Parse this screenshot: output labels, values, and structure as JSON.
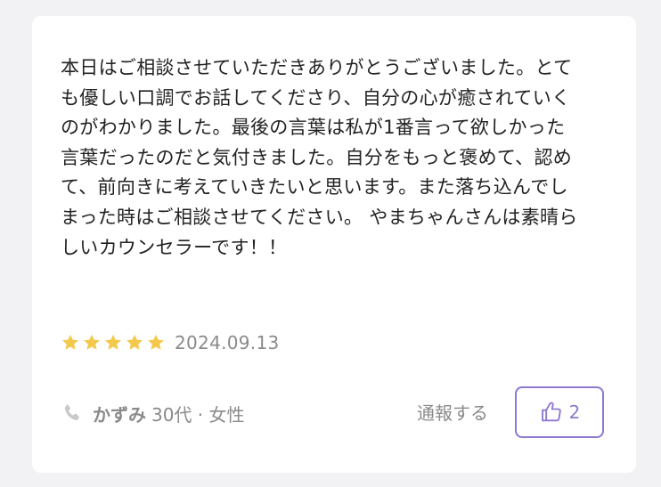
{
  "review": {
    "body_lines": [
      "本日はご相談させていただきありがとうございました。とて",
      "も優しい口調でお話してくださり、自分の心が癒されていく",
      "のがわかりました。最後の言葉は私が1番言って欲しかった",
      "言葉だったのだと気付きました。自分をもっと褒めて、認め",
      "て、前向きに考えていきたいと思います。また落ち込んでし",
      "まった時はご相談させてください。 やまちゃんさんは素晴ら",
      "しいカウンセラーです！！"
    ],
    "rating": 5,
    "rating_max": 5,
    "date": "2024.09.13",
    "author": {
      "name": "かずみ",
      "meta": "30代 · 女性",
      "icon": "phone-icon"
    },
    "report_label": "通報する",
    "like": {
      "icon": "thumbs-up-icon",
      "count": "2"
    }
  },
  "colors": {
    "star": "#f2c94c",
    "accent": "#8f78cf",
    "muted_text": "#8a8a8a",
    "body_text": "#222222",
    "page_background": "#f2f2f4"
  }
}
